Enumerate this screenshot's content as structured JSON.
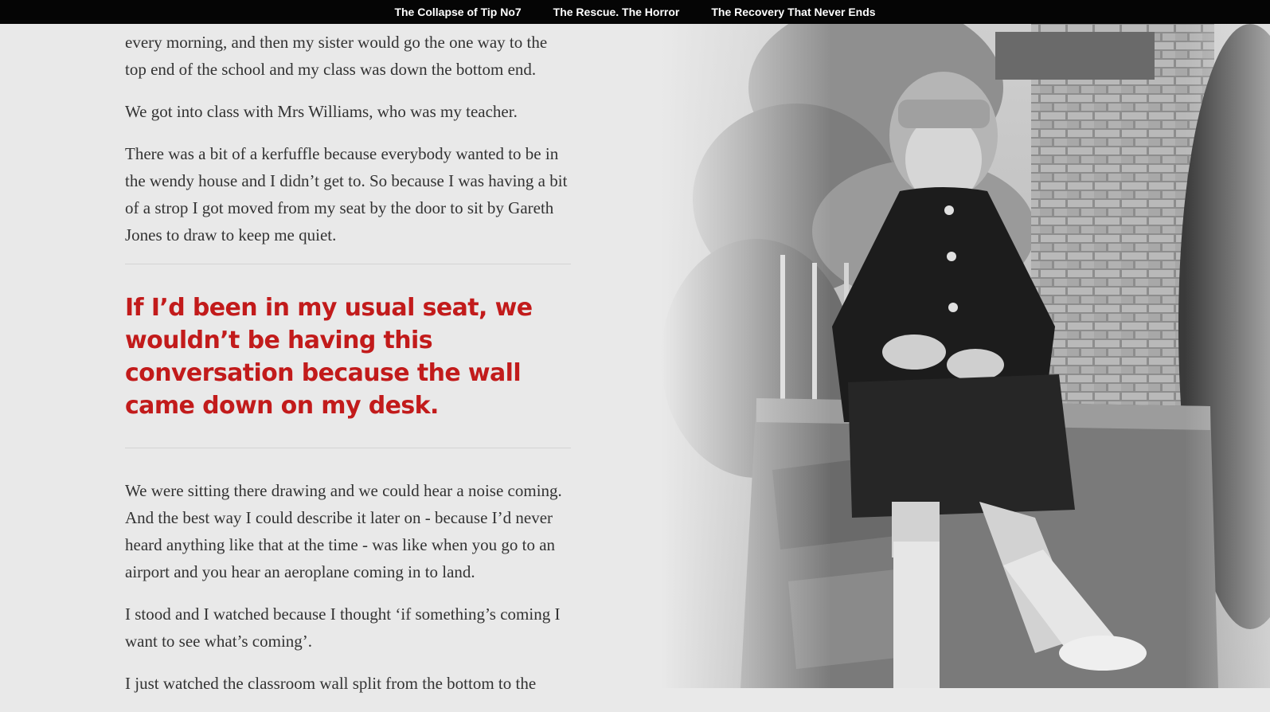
{
  "nav": {
    "items": [
      {
        "label": "The Collapse of Tip No7"
      },
      {
        "label": "The Rescue. The Horror"
      },
      {
        "label": "The Recovery That Never Ends"
      }
    ]
  },
  "article": {
    "paragraphs_before": [
      "every morning, and then my sister would go the one way to the top end of the school and my class was down the bottom end.",
      "We got into class with Mrs Williams, who was my teacher.",
      "There was a bit of a kerfuffle because everybody wanted to be in the wendy house and I didn’t get to. So because I was having a bit of a strop I got moved from my seat by the door to sit by Gareth Jones to draw to keep me quiet."
    ],
    "pullquote": "If I’d been in my usual seat, we wouldn’t be having this conversation because the wall came down on my desk.",
    "paragraphs_after": [
      "We were sitting there drawing and we could hear a noise coming. And the best way I could describe it later on - because I’d never heard anything like that at the time - was like when you go to an airport and you hear an aeroplane coming in to land.",
      "I stood and I watched because I thought ‘if something’s coming I want to see what’s coming’.",
      "I just watched the classroom wall split from the bottom to the"
    ]
  },
  "colors": {
    "nav_background": "#050505",
    "page_background": "#e9e9e9",
    "pullquote": "#c21b1b",
    "body_text": "#333333"
  }
}
